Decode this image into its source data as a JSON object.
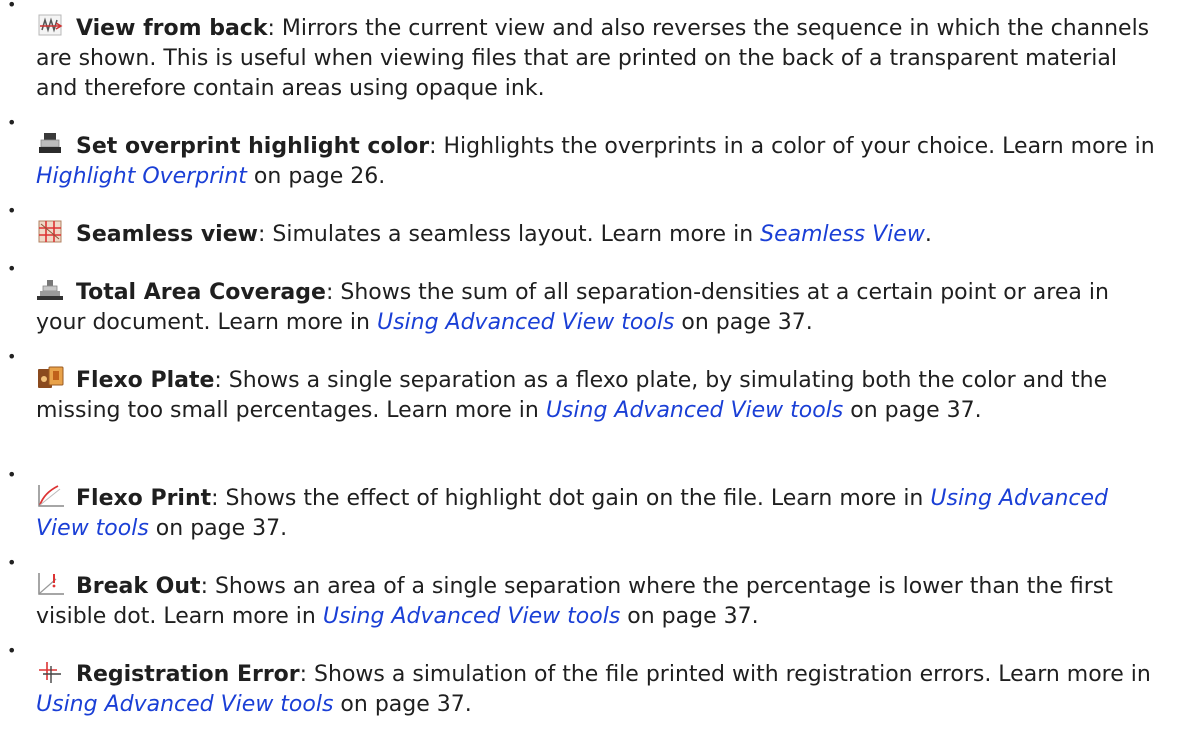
{
  "items": [
    {
      "icon": "view-from-back-icon",
      "term": "View from back",
      "desc": ": Mirrors the current view and also reverses the sequence in which the channels are shown. This is useful when viewing files that are printed on the back of a transparent material and therefore contain areas using opaque ink."
    },
    {
      "icon": "overprint-highlight-icon",
      "term": "Set overprint highlight color",
      "desc": ": Highlights the overprints in a color of your choice. Learn more in ",
      "link": "Highlight Overprint",
      "after": "  on page 26."
    },
    {
      "icon": "seamless-view-icon",
      "term": "Seamless view",
      "desc": ": Simulates a seamless layout. Learn more in ",
      "link": "Seamless View",
      "after": "."
    },
    {
      "icon": "total-area-coverage-icon",
      "term": "Total Area Coverage",
      "desc": ": Shows the sum of all separation-densities at a certain point or area in your document. Learn more in ",
      "link": "Using Advanced View tools",
      "after": " on page 37."
    },
    {
      "icon": "flexo-plate-icon",
      "term": "Flexo Plate",
      "desc": ": Shows a single separation as a flexo plate, by simulating both the color and the missing too small percentages. Learn more in ",
      "link": "Using Advanced View tools",
      "after": " on page 37."
    },
    {
      "icon": "flexo-print-icon",
      "term": "Flexo Print",
      "desc": ": Shows the effect of highlight dot gain on the file. Learn more in ",
      "link": "Using Advanced View tools",
      "after": " on page 37."
    },
    {
      "icon": "break-out-icon",
      "term": "Break Out",
      "desc": ": Shows an area of a single separation where the percentage is lower than the first visible dot. Learn more in ",
      "link": "Using Advanced View tools",
      "after": " on page 37."
    },
    {
      "icon": "registration-error-icon",
      "term": "Registration Error",
      "desc": ": Shows a simulation of the file printed with registration errors. Learn more in ",
      "link": "Using Advanced View tools",
      "after": " on page 37."
    }
  ]
}
